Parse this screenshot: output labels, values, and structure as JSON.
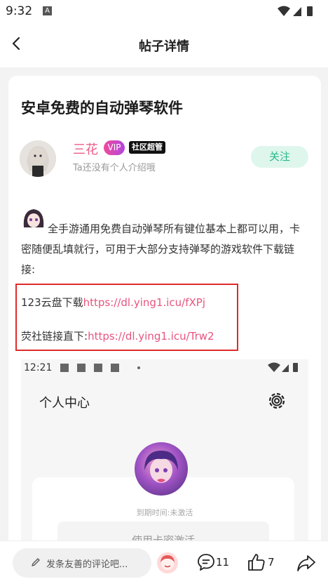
{
  "status_bar": {
    "time": "9:32",
    "notification_icon": "A"
  },
  "nav": {
    "title": "帖子详情"
  },
  "post": {
    "title": "安卓免费的自动弹琴软件",
    "author": {
      "name": "三花",
      "vip_label": "VIP",
      "badge": "社区超管",
      "bio": "Ta还没有个人介绍哦"
    },
    "follow_label": "关注",
    "body": "全手游通用免费自动弹琴所有键位基本上都可以用，卡密随便乱填就行，可用于大部分支持弹琴的游戏软件下载链接:",
    "links": [
      {
        "label": "123云盘下载",
        "url": "https://dl.ying1.icu/fXPj"
      },
      {
        "label": "荧社链接直下:",
        "url": "https://dl.ying1.icu/Trw2"
      }
    ],
    "screenshot": {
      "time": "12:21",
      "title": "个人中心",
      "expire_text": "到期时间:未激活",
      "button_text": "使用卡密激活"
    }
  },
  "bottom_bar": {
    "comment_placeholder": "发条友善的评论吧...",
    "comment_count": "11",
    "like_count": "7"
  },
  "colors": {
    "accent_pink": "#e8557d",
    "follow_green": "#26b98a",
    "highlight_red": "#e02b2b"
  }
}
